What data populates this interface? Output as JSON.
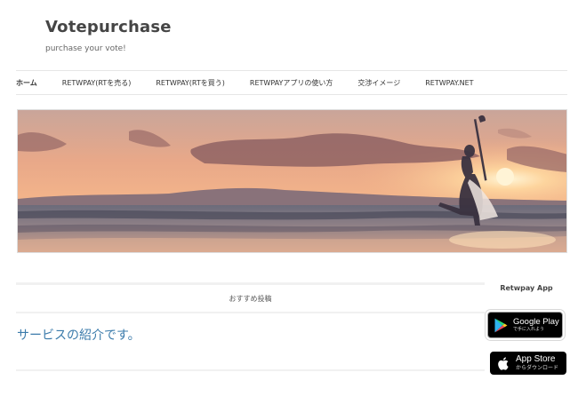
{
  "site": {
    "title": "Votepurchase",
    "tagline": "purchase your vote!"
  },
  "nav": {
    "items": [
      {
        "label": "ホーム",
        "active": true
      },
      {
        "label": "RETWPAY(RTを売る)"
      },
      {
        "label": "RETWPAY(RTを買う)"
      },
      {
        "label": "RETWPAYアプリの使い方"
      },
      {
        "label": "交渉イメージ"
      },
      {
        "label": "RETWPAY.NET"
      }
    ]
  },
  "hero": {
    "image": "sunset-beach-guitarist-silhouette"
  },
  "main": {
    "featured_label": "おすすめ投稿",
    "post_title": "サービスの紹介です。"
  },
  "sidebar": {
    "title": "Retwpay App",
    "google_play": {
      "main": "Google Play",
      "sub": "で手に入れよう",
      "icon": "google-play-icon"
    },
    "app_store": {
      "main": "App Store",
      "sub": "からダウンロード",
      "icon": "apple-icon"
    }
  }
}
